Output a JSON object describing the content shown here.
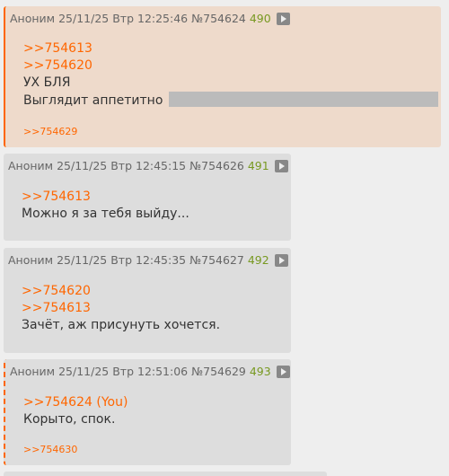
{
  "posts": [
    {
      "author": "Аноним",
      "date": "25/11/25 Втр 12:25:46",
      "id": "№754624",
      "number": "490",
      "links": [
        ">>754613",
        ">>754620"
      ],
      "lines": [
        "УХ БЛЯ",
        "Выглядит аппетитно"
      ],
      "replies": ">>754629"
    },
    {
      "author": "Аноним",
      "date": "25/11/25 Втр 12:45:15",
      "id": "№754626",
      "number": "491",
      "links": [
        ">>754613"
      ],
      "lines": [
        "Можно я за тебя выйду..."
      ]
    },
    {
      "author": "Аноним",
      "date": "25/11/25 Втр 12:45:35",
      "id": "№754627",
      "number": "492",
      "links": [
        ">>754620",
        ">>754613"
      ],
      "lines": [
        "Зачёт, аж присунуть хочется."
      ]
    },
    {
      "author": "Аноним",
      "date": "25/11/25 Втр 12:51:06",
      "id": "№754629",
      "number": "493",
      "links": [
        ">>754624 (You)"
      ],
      "lines": [
        "Корыто, спок."
      ],
      "replies": ">>754630"
    }
  ]
}
